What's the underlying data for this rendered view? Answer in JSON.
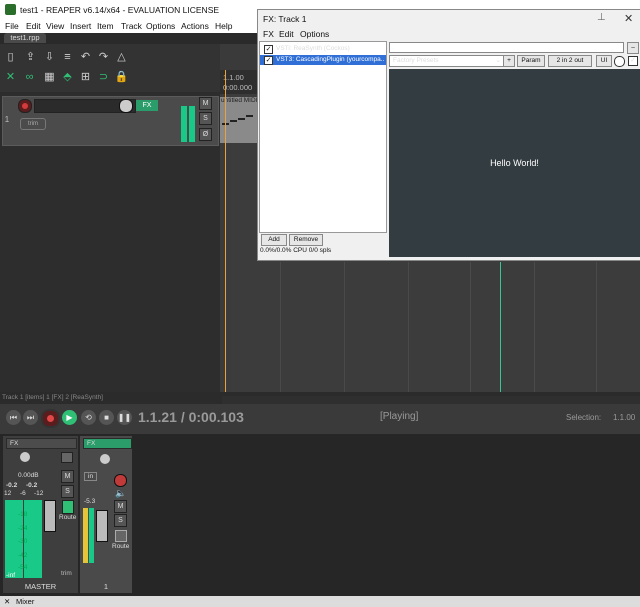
{
  "window": {
    "title": "test1 - REAPER v6.14/x64 - EVALUATION LICENSE"
  },
  "menu": [
    "File",
    "Edit",
    "View",
    "Insert",
    "Item",
    "Track",
    "Options",
    "Actions",
    "Help"
  ],
  "project_tab": "test1.rpp",
  "track": {
    "number": "1",
    "fx_label": "FX",
    "env_label": "trim",
    "mute": "M",
    "solo": "S",
    "phase": "Ø"
  },
  "arrange": {
    "ruler": "1.1.00",
    "ruler_time": "0:00.000",
    "item_label": "untitled MIDI"
  },
  "status": {
    "text": "Track 1 [items] 1 [FX] 2 [ReaSynth]"
  },
  "transport": {
    "time": "1.1.21 / 0:00.103",
    "state": "[Playing]",
    "selection_label": "Selection:",
    "selection_value": "1.1.00"
  },
  "mixer": {
    "master": {
      "fx": "FX",
      "db": "0.00dB",
      "peak_l": "-0.2",
      "peak_r": "-0.2",
      "name": "MASTER",
      "mute": "M",
      "solo": "S",
      "route": "Route",
      "mono": "trim"
    },
    "track1": {
      "fx": "FX",
      "db": "-5.3",
      "name": "1",
      "mute": "M",
      "solo": "S",
      "route": "Route",
      "io": "in"
    },
    "scale_labels": [
      "12",
      "-6",
      "-12",
      "-18",
      "-24",
      "-30",
      "-42",
      "-54",
      "-inf"
    ]
  },
  "mixer_tab": "Mixer",
  "fx_window": {
    "title": "FX: Track 1",
    "menu": [
      "FX",
      "Edit",
      "Options"
    ],
    "chain": [
      {
        "label": "VSTi: ReaSynth (Cockos)",
        "checked": true,
        "selected": false
      },
      {
        "label": "VST3: CascadingPlugin (yourcompa...",
        "checked": true,
        "selected": true
      }
    ],
    "add_label": "Add",
    "remove_label": "Remove",
    "cpu": "0.0%/0.0% CPU 0/0 spls",
    "preset": "Factory Presets",
    "plus": "+",
    "param": "Param",
    "io": "2 in 2 out",
    "ui": "UI",
    "plugin_text": "Hello World!"
  }
}
